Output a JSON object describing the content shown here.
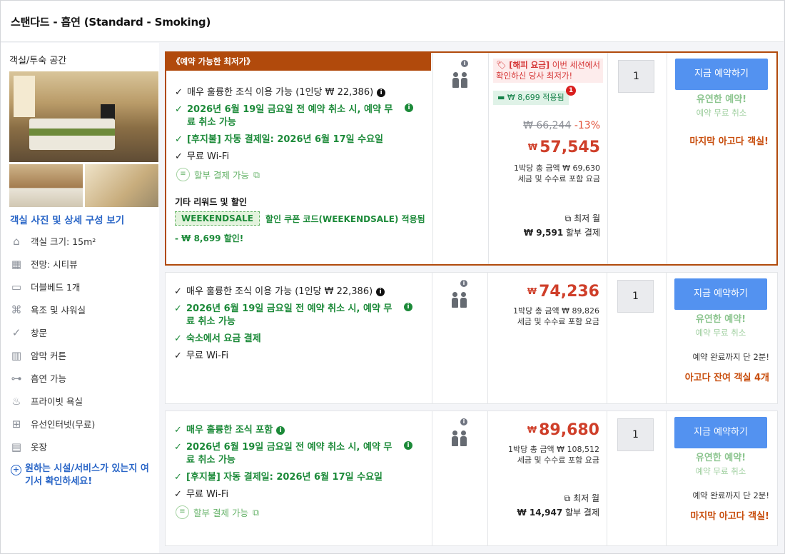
{
  "room": {
    "title": "스탠다드 - 흡연 (Standard - Smoking)"
  },
  "sidebar": {
    "title": "객실/투숙 공간",
    "photo_link": "객실 사진 및 상세 구성 보기",
    "amenities": [
      {
        "icon": "room-size-icon",
        "label": "객실 크기: 15m²"
      },
      {
        "icon": "view-icon",
        "label": "전망: 시티뷰"
      },
      {
        "icon": "bed-icon",
        "label": "더블베드 1개"
      },
      {
        "icon": "shower-icon",
        "label": "욕조 및 샤워실"
      },
      {
        "icon": "window-icon",
        "label": "창문"
      },
      {
        "icon": "curtain-icon",
        "label": "암막 커튼"
      },
      {
        "icon": "smoking-icon",
        "label": "흡연 가능"
      },
      {
        "icon": "private-bath-icon",
        "label": "프라이빗 욕실"
      },
      {
        "icon": "wired-internet-icon",
        "label": "유선인터넷(무료)"
      },
      {
        "icon": "wardrobe-icon",
        "label": "옷장"
      }
    ],
    "more_link": "원하는 시설/서비스가 있는지 여기서 확인하세요!"
  },
  "offers": [
    {
      "ribbon": "《예약 가능한 최저가》",
      "features": [
        "매우 훌륭한 조식 이용 가능 (1인당 ₩ 22,386)",
        "2026년 6월 19일 금요일 전 예약 취소 시, 예약 무료 취소 가능",
        "[후지불] 자동 결제일: 2026년 6월 17일 수요일",
        "무료 Wi-Fi"
      ],
      "pay_later": "할부 결제 가능",
      "discount_title": "기타 리워드 및 할인",
      "coupon_tag": "WEEKENDSALE",
      "coupon_text": "할인 쿠폰 코드(WEEKENDSALE) 적용됨",
      "coupon_amount": "- ₩ 8,699 할인!",
      "happy_label": "[해피 요금]",
      "happy_text": " 이번 세션에서 확인하신 당사 최저가!",
      "savings": "₩ 8,699 적용됨",
      "savings_badge": "1",
      "old_price": "₩ 66,244",
      "discount_pct": "-13%",
      "currency": "₩",
      "price": "57,545",
      "total_line": "1박당 총 금액 ₩ 69,630",
      "tax_line": "세금 및 수수료 포함 요금",
      "monthly_label": "최저 월",
      "monthly_amount": "₩ 9,591",
      "monthly_suffix": " 할부 결제",
      "qty": "1",
      "book_label": "지금 예약하기",
      "flex_title": "유연한 예약!",
      "flex_sub": "예약 무료 취소",
      "urgency": "마지막 아고다 객실!"
    },
    {
      "features": [
        "매우 훌륭한 조식 이용 가능 (1인당 ₩ 22,386)",
        "2026년 6월 19일 금요일 전 예약 취소 시, 예약 무료 취소 가능",
        "숙소에서 요금 결제",
        "무료 Wi-Fi"
      ],
      "currency": "₩",
      "price": "74,236",
      "total_line": "1박당 총 금액 ₩ 89,826",
      "tax_line": "세금 및 수수료 포함 요금",
      "qty": "1",
      "book_label": "지금 예약하기",
      "flex_title": "유연한 예약!",
      "flex_sub": "예약 무료 취소",
      "soon": "예약 완료까지 단 2분!",
      "urgency": "아고다 잔여 객실 4개"
    },
    {
      "features": [
        "매우 훌륭한 조식 포함",
        "2026년 6월 19일 금요일 전 예약 취소 시, 예약 무료 취소 가능",
        "[후지불] 자동 결제일: 2026년 6월 17일 수요일",
        "무료 Wi-Fi"
      ],
      "pay_later": "할부 결제 가능",
      "currency": "₩",
      "price": "89,680",
      "total_line": "1박당 총 금액 ₩ 108,512",
      "tax_line": "세금 및 수수료 포함 요금",
      "monthly_label": "최저 월",
      "monthly_amount": "₩ 14,947",
      "monthly_suffix": " 할부 결제",
      "qty": "1",
      "book_label": "지금 예약하기",
      "flex_title": "유연한 예약!",
      "flex_sub": "예약 무료 취소",
      "soon": "예약 완료까지 단 2분!",
      "urgency": "마지막 아고다 객실!"
    }
  ],
  "colors": {
    "accent_orange": "#b14a0c",
    "price_red": "#cf3f2a",
    "green": "#1c8a39",
    "book_blue": "#5392f0"
  }
}
